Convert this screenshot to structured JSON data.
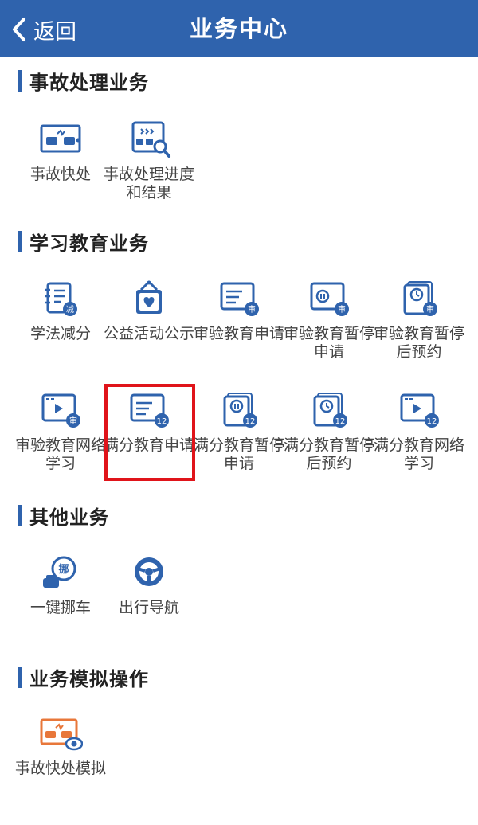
{
  "header": {
    "back_label": "返回",
    "title": "业务中心"
  },
  "sections": [
    {
      "title": "事故处理业务",
      "items": [
        {
          "label": "事故快处",
          "icon": "accident-quick-icon"
        },
        {
          "label": "事故处理进度和结果",
          "icon": "accident-progress-icon"
        }
      ]
    },
    {
      "title": "学习教育业务",
      "items": [
        {
          "label": "学法减分",
          "icon": "study-reduce-points-icon"
        },
        {
          "label": "公益活动公示",
          "icon": "charity-activity-icon"
        },
        {
          "label": "审验教育申请",
          "icon": "review-education-apply-icon",
          "badge": "审"
        },
        {
          "label": "审验教育暂停申请",
          "icon": "review-education-pause-icon",
          "badge": "审"
        },
        {
          "label": "审验教育暂停后预约",
          "icon": "review-education-reserve-icon",
          "badge": "审"
        },
        {
          "label": "审验教育网络学习",
          "icon": "review-education-online-icon",
          "badge": "审"
        },
        {
          "label": "满分教育申请",
          "icon": "full-score-education-apply-icon",
          "badge": "12"
        },
        {
          "label": "满分教育暂停申请",
          "icon": "full-score-education-pause-icon",
          "badge": "12"
        },
        {
          "label": "满分教育暂停后预约",
          "icon": "full-score-education-reserve-icon",
          "badge": "12"
        },
        {
          "label": "满分教育网络学习",
          "icon": "full-score-education-online-icon",
          "badge": "12"
        }
      ]
    },
    {
      "title": "其他业务",
      "items": [
        {
          "label": "一键挪车",
          "icon": "move-car-icon",
          "badge": "挪"
        },
        {
          "label": "出行导航",
          "icon": "navigation-wheel-icon"
        }
      ]
    },
    {
      "title": "业务模拟操作",
      "items": [
        {
          "label": "事故快处模拟",
          "icon": "accident-simulation-icon"
        }
      ]
    }
  ],
  "colors": {
    "primary": "#2f63ad",
    "highlight": "#e0141a",
    "simulation": "#e8773a"
  }
}
